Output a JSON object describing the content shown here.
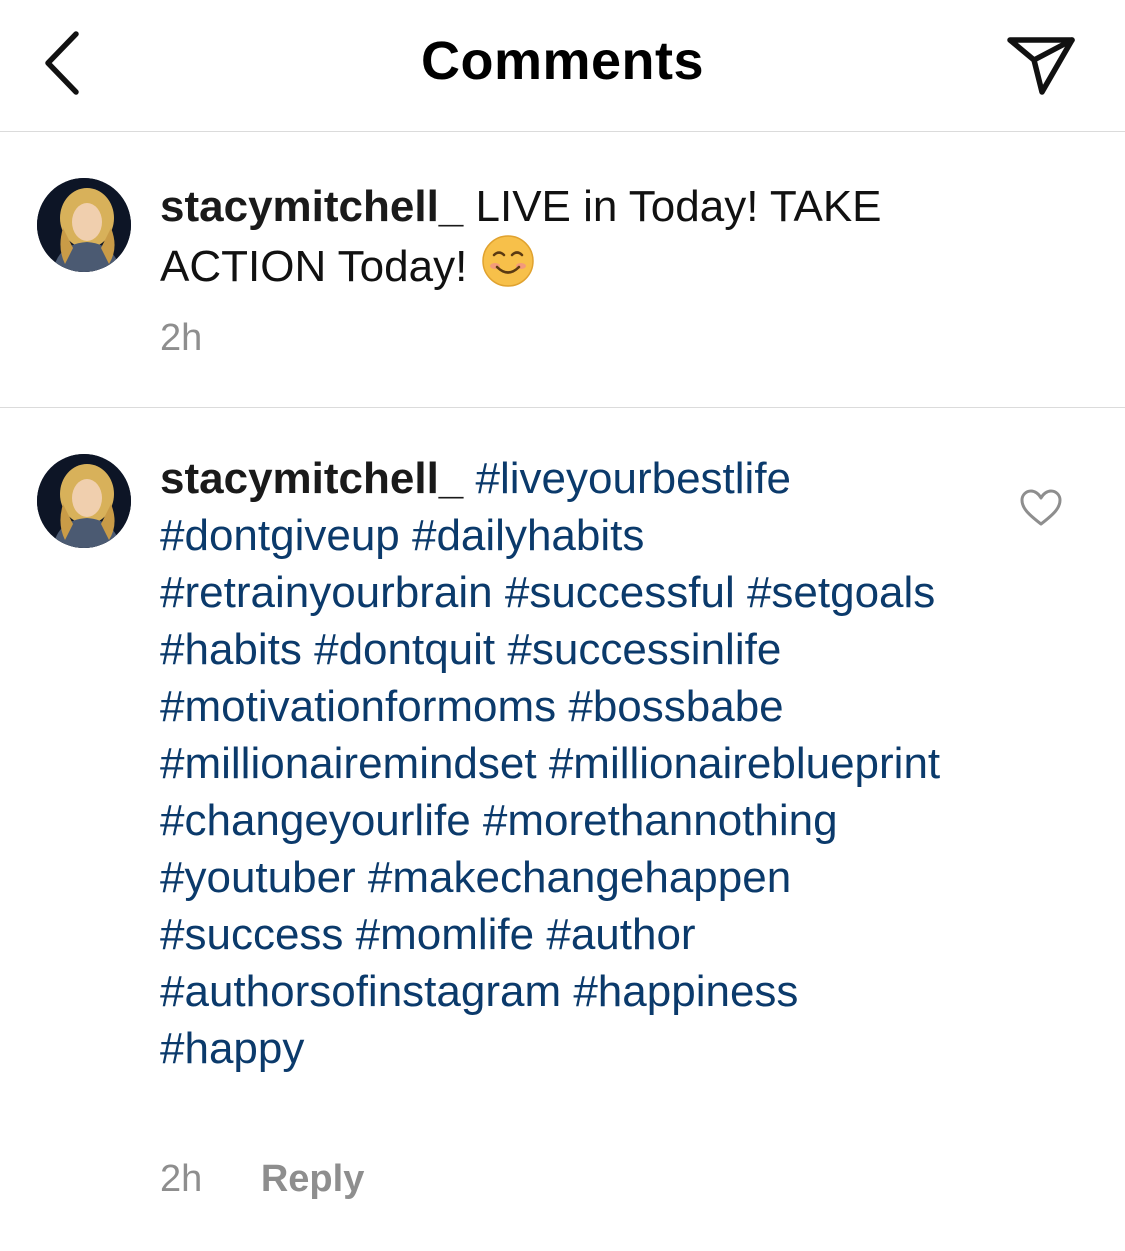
{
  "header": {
    "title": "Comments",
    "back_icon": "chevron-left-icon",
    "share_icon": "paper-plane-icon"
  },
  "caption": {
    "username": "stacymitchell_",
    "text": "LIVE  in Today! TAKE ACTION Today!",
    "emoji": "smiling-face-icon",
    "time": "2h"
  },
  "comment": {
    "username": "stacymitchell_",
    "hashtags": "#liveyourbestlife #dontgiveup #dailyhabits #retrainyourbrain #successful #setgoals #habits #dontquit #successinlife #motivationformoms #bossbabe #millionairemindset #millionaireblueprint #changeyourlife #morethannothing #youtuber #makechangehappen #success #momlife #author #authorsofinstagram #happiness #happy",
    "time": "2h",
    "reply_label": "Reply",
    "like_icon": "heart-outline-icon"
  },
  "colors": {
    "hashtag": "#0b3a6b",
    "meta": "#8e8e8e",
    "divider": "#dbdbdb"
  }
}
